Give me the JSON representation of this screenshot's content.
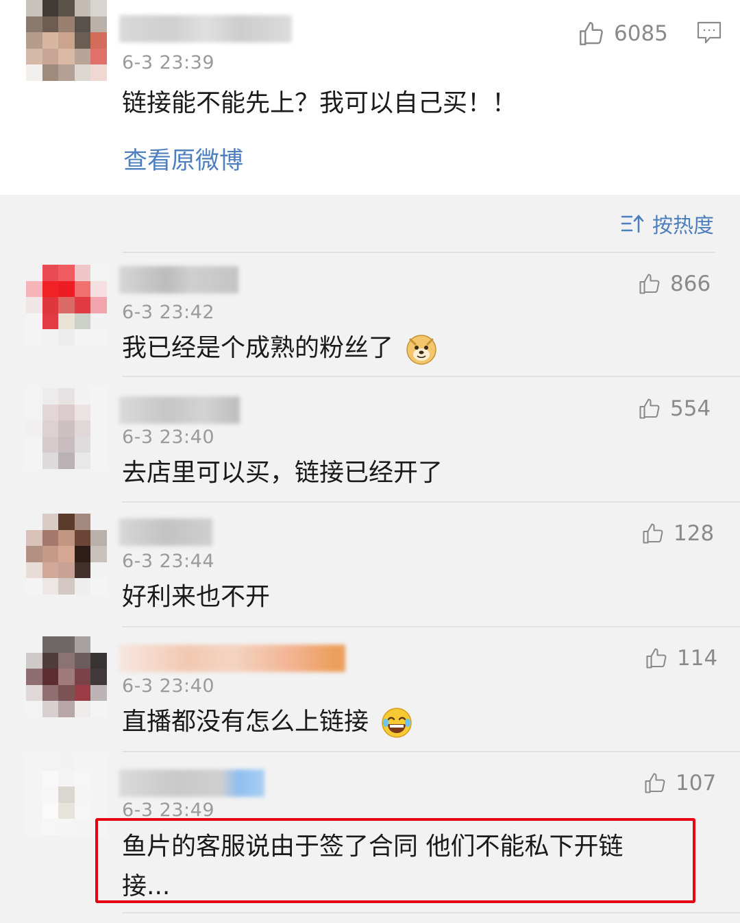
{
  "main_post": {
    "time": "6-3 23:39",
    "content": "链接能不能先上？我可以自己买！！",
    "likes": "6085",
    "view_original": "查看原微博"
  },
  "sort": {
    "label": "按热度"
  },
  "comments": [
    {
      "time": "6-3 23:42",
      "content": "我已经是个成熟的粉丝了",
      "likes": "866",
      "emoji": "doge-emoji"
    },
    {
      "time": "6-3 23:40",
      "content": "去店里可以买，链接已经开了",
      "likes": "554"
    },
    {
      "time": "6-3 23:44",
      "content": "好利来也不开",
      "likes": "128"
    },
    {
      "time": "6-3 23:40",
      "content": "直播都没有怎么上链接",
      "likes": "114",
      "emoji": "laugh-cry-emoji"
    },
    {
      "time": "6-3 23:49",
      "content_line1": "鱼片的客服说由于签了合同 他们不能私下开链",
      "content_line2": "接...",
      "likes": "107"
    }
  ],
  "colors": {
    "link": "#4d7fbf",
    "highlight_border": "#e60012",
    "time": "#9a9a9a"
  }
}
